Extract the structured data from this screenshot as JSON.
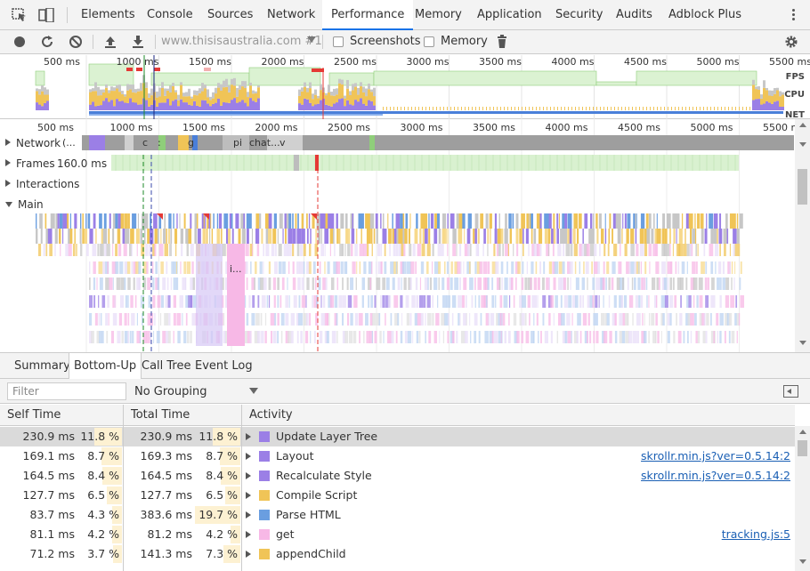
{
  "tabs": [
    {
      "label": "Elements"
    },
    {
      "label": "Console"
    },
    {
      "label": "Sources"
    },
    {
      "label": "Network"
    },
    {
      "label": "Performance",
      "active": true
    },
    {
      "label": "Memory"
    },
    {
      "label": "Application"
    },
    {
      "label": "Security"
    },
    {
      "label": "Audits"
    },
    {
      "label": "Adblock Plus"
    }
  ],
  "toolbar": {
    "url": "www.thisisaustralia.com #1",
    "screenshots_label": "Screenshots",
    "memory_label": "Memory"
  },
  "overview": {
    "ticks": [
      "500 ms",
      "1000 ms",
      "1500 ms",
      "2000 ms",
      "2500 ms",
      "3000 ms",
      "3500 ms",
      "4000 ms",
      "4500 ms",
      "5000 ms",
      "5500 ms"
    ],
    "fps_label": "FPS",
    "cpu_label": "CPU",
    "net_label": "NET"
  },
  "timeline": {
    "ticks": [
      "500 ms",
      "1000 ms",
      "1500 ms",
      "2000 ms",
      "2500 ms",
      "3000 ms",
      "3500 ms",
      "4000 ms",
      "4500 ms",
      "5000 ms",
      "5500 ms"
    ],
    "tracks": {
      "network": "Network",
      "network_snippets": [
        "(...",
        "c",
        ":",
        "g",
        "pi",
        "chat...",
        "v"
      ],
      "frames": "Frames",
      "frames_value": "160.0 ms",
      "interactions": "Interactions",
      "main": "Main",
      "main_snippet": "i..."
    }
  },
  "bottom_tabs": [
    {
      "label": "Summary"
    },
    {
      "label": "Bottom-Up",
      "active": true
    },
    {
      "label": "Call Tree"
    },
    {
      "label": "Event Log"
    }
  ],
  "filter": {
    "placeholder": "Filter",
    "grouping": "No Grouping"
  },
  "table": {
    "headers": {
      "self": "Self Time",
      "total": "Total Time",
      "activity": "Activity"
    },
    "rows": [
      {
        "self": "230.9 ms",
        "self_pct": "11.8 %",
        "total": "230.9 ms",
        "total_pct": "11.8 %",
        "activity": "Update Layer Tree",
        "color": "#9b7fe6",
        "link": ""
      },
      {
        "self": "169.1 ms",
        "self_pct": "8.7 %",
        "total": "169.3 ms",
        "total_pct": "8.7 %",
        "activity": "Layout",
        "color": "#9b7fe6",
        "link": "skrollr.min.js?ver=0.5.14:2"
      },
      {
        "self": "164.5 ms",
        "self_pct": "8.4 %",
        "total": "164.5 ms",
        "total_pct": "8.4 %",
        "activity": "Recalculate Style",
        "color": "#9b7fe6",
        "link": "skrollr.min.js?ver=0.5.14:2"
      },
      {
        "self": "127.7 ms",
        "self_pct": "6.5 %",
        "total": "127.7 ms",
        "total_pct": "6.5 %",
        "activity": "Compile Script",
        "color": "#f0c457",
        "link": ""
      },
      {
        "self": "83.7 ms",
        "self_pct": "4.3 %",
        "total": "383.6 ms",
        "total_pct": "19.7 %",
        "activity": "Parse HTML",
        "color": "#6a9ee0",
        "link": ""
      },
      {
        "self": "81.1 ms",
        "self_pct": "4.2 %",
        "total": "81.2 ms",
        "total_pct": "4.2 %",
        "activity": "get",
        "color": "#f7b8e6",
        "link": "tracking.js:5"
      },
      {
        "self": "71.2 ms",
        "self_pct": "3.7 %",
        "total": "141.3 ms",
        "total_pct": "7.3 %",
        "activity": "appendChild",
        "color": "#f0c457",
        "link": ""
      }
    ]
  }
}
